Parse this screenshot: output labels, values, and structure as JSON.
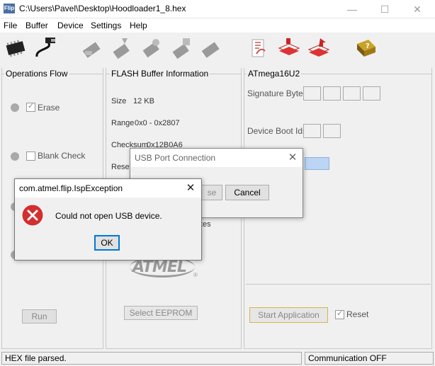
{
  "window": {
    "title": "C:\\Users\\Pavel\\Desktop\\Hoodloader1_8.hex",
    "app_icon": "Flip",
    "minimize_glyph": "—",
    "maximize_glyph": "☐",
    "close_glyph": "✕"
  },
  "menu": {
    "file": "File",
    "buffer": "Buffer",
    "device": "Device",
    "settings": "Settings",
    "help": "Help"
  },
  "toolbar": {
    "icons": [
      "chip-icon",
      "usb-cable-icon",
      "erase-icon",
      "program-icon",
      "verify-icon",
      "read-icon",
      "blank-check-icon",
      "load-hex-icon",
      "buffer-edit-icon",
      "save-icon",
      "help-book-icon"
    ]
  },
  "operations": {
    "title": "Operations Flow",
    "erase": "Erase",
    "blank_check": "Blank Check",
    "run": "Run"
  },
  "flash": {
    "title": "FLASH Buffer Information",
    "size_label": "Size",
    "size_value": "12 KB",
    "range_label": "Range",
    "range_value": "0x0 - 0x2807",
    "checksum_label": "Checksum",
    "checksum_value": "0x12B0A6",
    "reset_partial": "Reset",
    "bytes_partial": "tes",
    "select_eeprom": "Select EEPROM",
    "logo_text": "ATMEL",
    "logo_mark": "®"
  },
  "device": {
    "title": "ATmega16U2",
    "signature_label": "Signature Bytes",
    "boot_ids_label": "Device Boot Ids",
    "start_app": "Start Application",
    "reset": "Reset"
  },
  "status": {
    "left": "HEX file parsed.",
    "right": "Communication OFF"
  },
  "usb_dialog": {
    "title": "USB Port Connection",
    "partial_button": "se",
    "cancel": "Cancel"
  },
  "error_dialog": {
    "title": "com.atmel.flip.IspException",
    "message": "Could not open USB device.",
    "ok": "OK"
  },
  "colors": {
    "error_red": "#d32f2f",
    "focus_blue": "#0078d7",
    "highlight_field": "#bdd5f5"
  }
}
